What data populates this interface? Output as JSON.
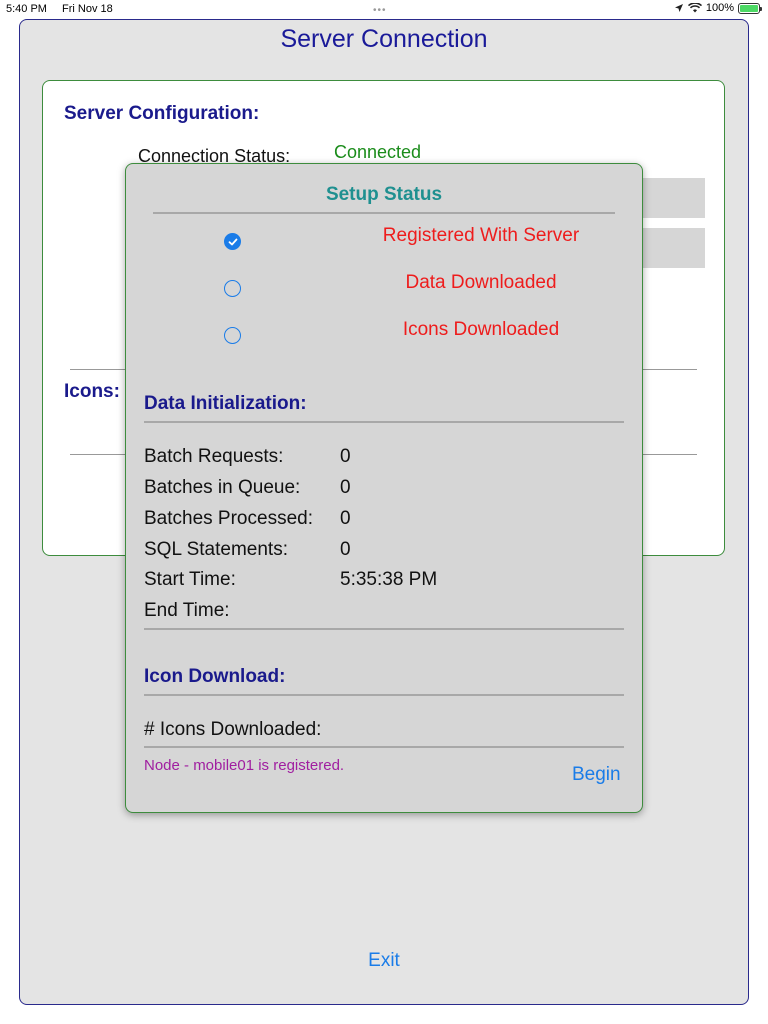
{
  "status_bar": {
    "time": "5:40 PM",
    "date": "Fri Nov 18",
    "battery": "100%"
  },
  "window": {
    "title": "Server Connection"
  },
  "config": {
    "heading": "Server Configuration:",
    "connection_status_label": "Connection Status:",
    "connection_status_value": "Connected",
    "icons_label": "Icons:"
  },
  "dialog": {
    "title": "Setup Status",
    "steps": [
      {
        "label": "Registered With Server",
        "done": true
      },
      {
        "label": "Data Downloaded",
        "done": false
      },
      {
        "label": "Icons Downloaded",
        "done": false
      }
    ],
    "data_init": {
      "heading": "Data Initialization:",
      "rows": [
        {
          "label": "Batch Requests:",
          "value": "0"
        },
        {
          "label": "Batches in Queue:",
          "value": "0"
        },
        {
          "label": "Batches Processed:",
          "value": "0"
        },
        {
          "label": "SQL Statements:",
          "value": "0"
        },
        {
          "label": "Start Time:",
          "value": "5:35:38 PM"
        },
        {
          "label": "End Time:",
          "value": ""
        }
      ]
    },
    "icon_download": {
      "heading": "Icon Download:",
      "count_label": "# Icons Downloaded:",
      "count_value": ""
    },
    "message": "Node - mobile01 is registered.",
    "begin_label": "Begin"
  },
  "exit_label": "Exit",
  "colors": {
    "accent_blue": "#1a7ce8",
    "heading_navy": "#1a1a8c",
    "status_red": "#ee1c1c",
    "connected_green": "#1a8c1a",
    "title_teal": "#1f9090",
    "message_purple": "#a01ea0"
  }
}
